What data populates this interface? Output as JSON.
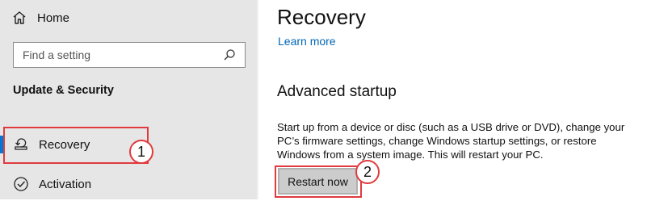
{
  "sidebar": {
    "home_label": "Home",
    "search_placeholder": "Find a setting",
    "section_title": "Update & Security",
    "items": [
      {
        "label": "Recovery",
        "icon": "recovery-icon",
        "selected": true
      },
      {
        "label": "Activation",
        "icon": "activation-icon",
        "selected": false
      }
    ]
  },
  "main": {
    "title": "Recovery",
    "learn_more": "Learn more",
    "advanced_startup": {
      "title": "Advanced startup",
      "description": "Start up from a device or disc (such as a USB drive or DVD), change your PC’s firmware settings, change Windows startup settings, or restore Windows from a system image. This will restart your PC.",
      "button_label": "Restart now"
    }
  },
  "annotations": {
    "step1": "1",
    "step2": "2"
  },
  "colors": {
    "accent": "#0078d7",
    "annotation": "#e03a3e",
    "link": "#0066b4",
    "sidebar_bg": "#e6e6e6"
  }
}
